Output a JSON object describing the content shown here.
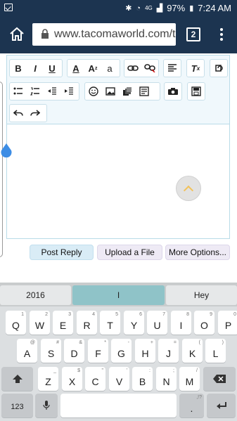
{
  "status": {
    "battery": "97%",
    "time": "7:24 AM",
    "network": "4G"
  },
  "browser": {
    "url": "www.tacomaworld.com/t",
    "tab_count": "2"
  },
  "toolbar": {
    "bold": "B",
    "italic": "I",
    "underline": "U",
    "font_color": "A",
    "font_size": "A",
    "font_size_sup": "z",
    "font_family": "a",
    "clear_format": "T",
    "clear_format_sub": "x"
  },
  "actions": {
    "post_reply": "Post Reply",
    "upload_file": "Upload a File",
    "more_options": "More Options..."
  },
  "keyboard": {
    "suggestions": [
      "2016",
      "I",
      "Hey"
    ],
    "row1": [
      {
        "k": "Q",
        "h": "1"
      },
      {
        "k": "W",
        "h": "2"
      },
      {
        "k": "E",
        "h": "3"
      },
      {
        "k": "R",
        "h": "4"
      },
      {
        "k": "T",
        "h": "5"
      },
      {
        "k": "Y",
        "h": "6"
      },
      {
        "k": "U",
        "h": "7"
      },
      {
        "k": "I",
        "h": "8"
      },
      {
        "k": "O",
        "h": "9"
      },
      {
        "k": "P",
        "h": "0"
      }
    ],
    "row2": [
      {
        "k": "A",
        "h": "@"
      },
      {
        "k": "S",
        "h": "#"
      },
      {
        "k": "D",
        "h": "&"
      },
      {
        "k": "F",
        "h": "*"
      },
      {
        "k": "G",
        "h": "-"
      },
      {
        "k": "H",
        "h": "+"
      },
      {
        "k": "J",
        "h": "="
      },
      {
        "k": "K",
        "h": "("
      },
      {
        "k": "L",
        "h": ")"
      }
    ],
    "row3": [
      {
        "k": "Z",
        "h": "_"
      },
      {
        "k": "X",
        "h": "$"
      },
      {
        "k": "C",
        "h": "\""
      },
      {
        "k": "V",
        "h": "'"
      },
      {
        "k": "B",
        "h": ":"
      },
      {
        "k": "N",
        "h": ";"
      },
      {
        "k": "M",
        "h": "/"
      }
    ],
    "symbols_key": "123",
    "punct_key": ".",
    "punct_hint": ",!?"
  },
  "colors": {
    "browser_bar": "#1c3450",
    "toolbar_bg": "#f0f8fc",
    "editor_border": "#b9dbe8",
    "suggestion_active": "#8fc3c8",
    "cursor_handle": "#3d8de5"
  }
}
